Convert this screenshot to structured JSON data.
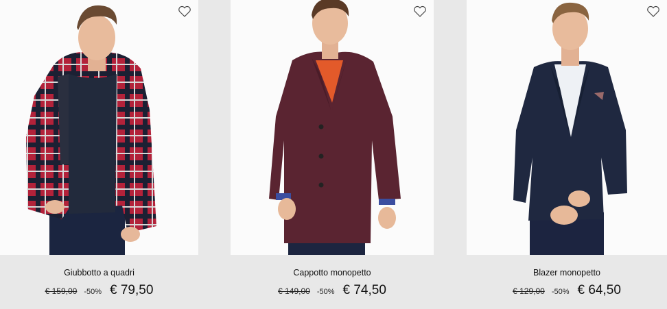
{
  "products": [
    {
      "name": "Giubbotto a quadri",
      "old_price": "€ 159,00",
      "discount": "-50%",
      "price": "€ 79,50",
      "wishlist_icon": "heart-outline-icon"
    },
    {
      "name": "Cappotto monopetto",
      "old_price": "€ 149,00",
      "discount": "-50%",
      "price": "€ 74,50",
      "wishlist_icon": "heart-outline-icon"
    },
    {
      "name": "Blazer monopetto",
      "old_price": "€ 129,00",
      "discount": "-50%",
      "price": "€ 64,50",
      "wishlist_icon": "heart-outline-icon"
    }
  ],
  "colors": {
    "background": "#e8e8e8",
    "photo_background": "#fbfbfb",
    "check_red": "#b3223a",
    "coat_burgundy": "#5a2431",
    "blazer_navy": "#1f2840"
  }
}
